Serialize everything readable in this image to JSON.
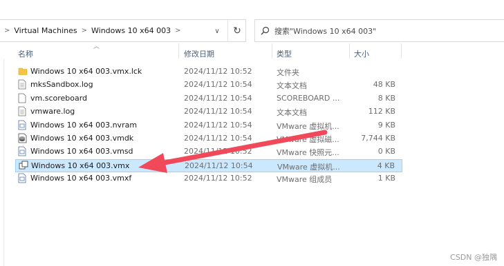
{
  "address_bar": {
    "crumbs": [
      "Virtual Machines",
      "Windows 10 x64 003"
    ],
    "separator": ">",
    "dropdown_glyph": "∨",
    "refresh_glyph": "↻"
  },
  "search": {
    "placeholder": "搜索\"Windows 10 x64 003\""
  },
  "columns": {
    "name": "名称",
    "date": "修改日期",
    "type": "类型",
    "size": "大小"
  },
  "files": [
    {
      "name": "Windows 10 x64 003.vmx.lck",
      "date": "2024/11/12 10:52",
      "type": "文件夹",
      "size": "",
      "icon": "folder-icon"
    },
    {
      "name": "mksSandbox.log",
      "date": "2024/11/12 10:54",
      "type": "文本文档",
      "size": "48 KB",
      "icon": "text-file-icon"
    },
    {
      "name": "vm.scoreboard",
      "date": "2024/11/12 10:54",
      "type": "SCOREBOARD ...",
      "size": "8 KB",
      "icon": "file-icon"
    },
    {
      "name": "vmware.log",
      "date": "2024/11/12 10:54",
      "type": "文本文档",
      "size": "112 KB",
      "icon": "text-file-icon"
    },
    {
      "name": "Windows 10 x64 003.nvram",
      "date": "2024/11/12 10:54",
      "type": "VMware 虚拟机...",
      "size": "9 KB",
      "icon": "vmware-file-icon"
    },
    {
      "name": "Windows 10 x64 003.vmdk",
      "date": "2024/11/12 10:54",
      "type": "VMware 虚拟磁...",
      "size": "7,744 KB",
      "icon": "vmdk-disk-icon"
    },
    {
      "name": "Windows 10 x64 003.vmsd",
      "date": "2024/11/12 10:52",
      "type": "VMware 快照元...",
      "size": "0 KB",
      "icon": "vmware-file-icon"
    },
    {
      "name": "Windows 10 x64 003.vmx",
      "date": "2024/11/12 10:54",
      "type": "VMware 虚拟机...",
      "size": "4 KB",
      "icon": "vmx-config-icon",
      "selected": true
    },
    {
      "name": "Windows 10 x64 003.vmxf",
      "date": "2024/11/12 10:52",
      "type": "VMware 组成员",
      "size": "1 KB",
      "icon": "vmware-file-icon"
    }
  ],
  "watermark": "CSDN @独隅",
  "colors": {
    "selection_bg": "#cce8ff",
    "selection_border": "#99d1ff",
    "arrow": "#f04a5a",
    "folder": "#f5c542"
  }
}
